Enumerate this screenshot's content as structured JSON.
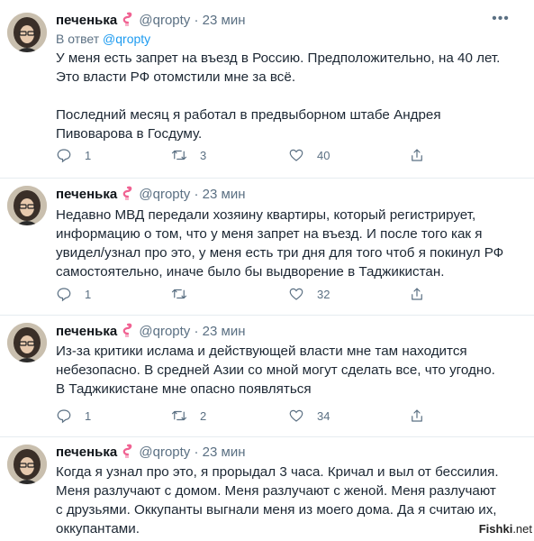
{
  "colors": {
    "link": "#1d9bf0",
    "muted": "#5b7083",
    "text": "#0f1419",
    "divider": "#e6ecf0"
  },
  "icons": {
    "reply": "comment-icon",
    "retweet": "retweet-icon",
    "like": "heart-icon",
    "share": "share-icon",
    "more": "more-icon",
    "emoji": "flamingo-emoji"
  },
  "tweets": [
    {
      "name": "печенька",
      "handle": "@qropty",
      "dot": "·",
      "time": "23 мин",
      "reply_prefix": "В ответ",
      "reply_handle": "@qropty",
      "paragraphs": [
        "У меня есть запрет на въезд в Россию. Предположительно, на 40 лет. Это власти РФ отомстили мне за всё.",
        "Последний месяц я работал в предвыборном штабе Андрея Пивоварова в Госдуму."
      ],
      "replies": "1",
      "retweets": "3",
      "likes": "40"
    },
    {
      "name": "печенька",
      "handle": "@qropty",
      "dot": "·",
      "time": "23 мин",
      "paragraphs": [
        "Недавно МВД передали хозяину квартиры, который регистрирует, информацию о том, что у меня запрет на въезд. И после того как я увидел/узнал про это, у меня есть три дня для того чтоб я покинул РФ самостоятельно, иначе было бы выдворение в Таджикистан."
      ],
      "replies": "1",
      "retweets": "",
      "likes": "32"
    },
    {
      "name": "печенька",
      "handle": "@qropty",
      "dot": "·",
      "time": "23 мин",
      "paragraphs": [
        "Из-за критики ислама и действующей власти мне там находится небезопасно. В средней Азии со мной могут сделать все, что угодно. В Таджикистане мне опасно появляться"
      ],
      "replies": "1",
      "retweets": "2",
      "likes": "34"
    },
    {
      "name": "печенька",
      "handle": "@qropty",
      "dot": "·",
      "time": "23 мин",
      "paragraphs": [
        "Когда я узнал про это, я прорыдал 3 часа. Кричал и выл от бессилия. Меня разлучают с домом. Меня разлучают с женой. Меня разлучают с друзьями. Оккупанты выгнали меня из моего дома. Да я считаю их, оккупантами."
      ]
    }
  ],
  "watermark": {
    "brand": "Fishki",
    "suffix": ".net"
  }
}
